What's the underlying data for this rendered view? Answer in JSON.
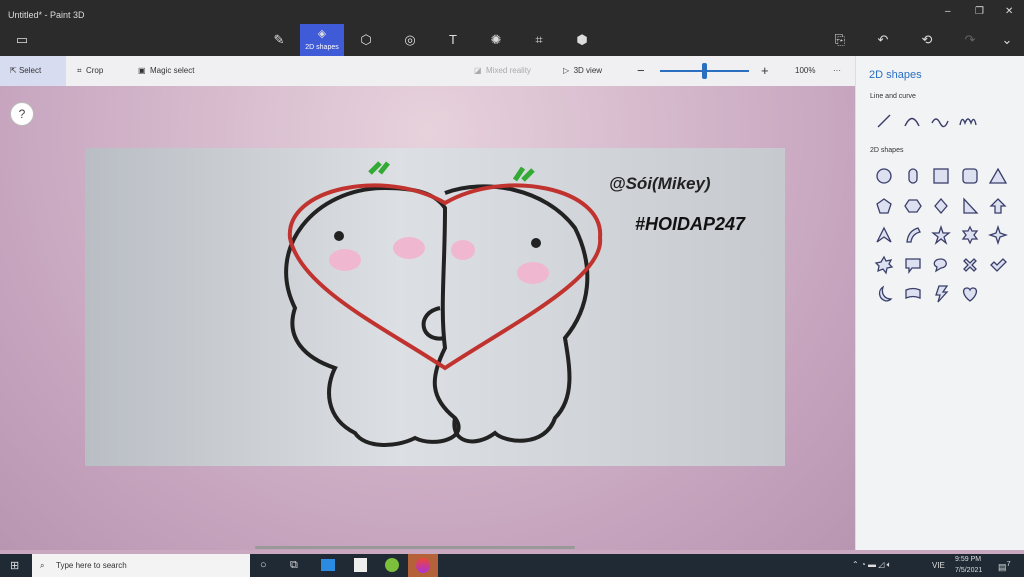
{
  "window": {
    "title": "Untitled* - Paint 3D",
    "minimize": "–",
    "restore": "❐",
    "close": "✕"
  },
  "toolbar": {
    "menu_icon": "▭",
    "tools": [
      {
        "name": "brushes",
        "glyph": "✎"
      },
      {
        "name": "2d-shapes",
        "glyph": "◈",
        "label": "2D shapes"
      },
      {
        "name": "3d-shapes",
        "glyph": "⬡"
      },
      {
        "name": "stickers",
        "glyph": "◎"
      },
      {
        "name": "text",
        "glyph": "T"
      },
      {
        "name": "effects",
        "glyph": "✺"
      },
      {
        "name": "canvas",
        "glyph": "⌗"
      },
      {
        "name": "3d-library",
        "glyph": "⬢"
      }
    ],
    "paste": "⎘",
    "undo": "↶",
    "history": "⟲",
    "redo": "↷",
    "expand": "⌄"
  },
  "subbar": {
    "select": "Select",
    "crop": "Crop",
    "magic_select": "Magic select",
    "mixed_reality": "Mixed reality",
    "view3d": "3D view",
    "zoom_out": "−",
    "zoom_in": "+",
    "zoom_label": "100%",
    "zoom_fraction": 0.5,
    "more": "···"
  },
  "canvas": {
    "help": "?",
    "text1": "@Sói(Mikey)",
    "text2": "#HOIDAP247"
  },
  "panel": {
    "title": "2D shapes",
    "lines_heading": "Line and curve",
    "shapes_heading": "2D shapes"
  },
  "taskbar": {
    "search_placeholder": "Type here to search",
    "time": "9:59 PM",
    "date": "7/5/2021",
    "lang": "VIE",
    "notifications": "7"
  }
}
